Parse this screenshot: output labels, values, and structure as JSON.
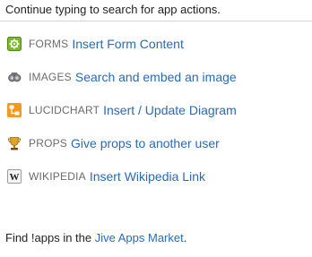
{
  "header": {
    "text": "Continue typing to search for app actions."
  },
  "apps": [
    {
      "tag": "FORMS",
      "action": "Insert Form Content",
      "icon": "forms-icon"
    },
    {
      "tag": "IMAGES",
      "action": "Search and embed an image",
      "icon": "images-icon"
    },
    {
      "tag": "LUCIDCHART",
      "action": "Insert / Update Diagram",
      "icon": "lucidchart-icon"
    },
    {
      "tag": "PROPS",
      "action": "Give props to another user",
      "icon": "props-icon"
    },
    {
      "tag": "WIKIPEDIA",
      "action": "Insert Wikipedia Link",
      "icon": "wikipedia-icon"
    }
  ],
  "footer": {
    "prefix": "Find !apps in the ",
    "link": "Jive Apps Market",
    "suffix": "."
  },
  "colors": {
    "link": "#2b6ab5",
    "tag": "#6b6b6b",
    "text": "#222222"
  }
}
